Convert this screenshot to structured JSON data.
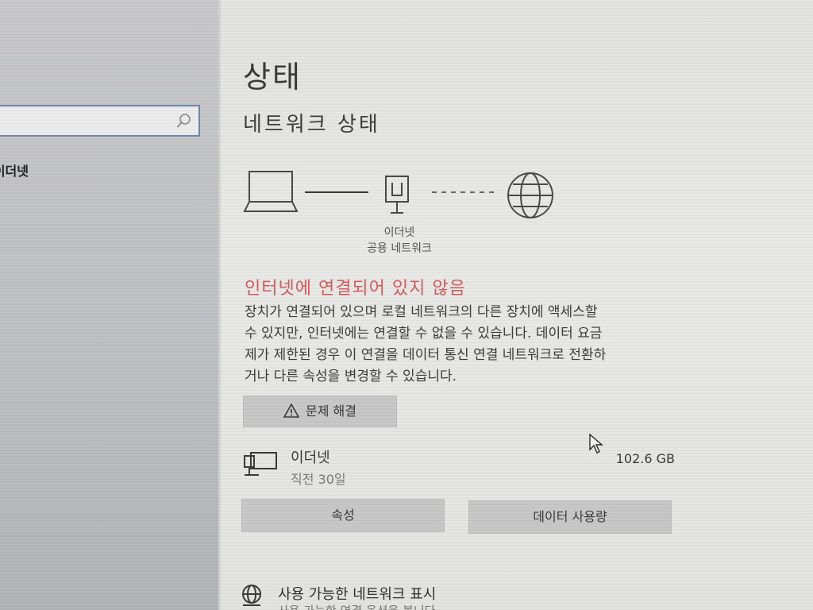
{
  "sidebar": {
    "search": {
      "placeholder": "",
      "icon": "search-icon"
    },
    "items": [
      {
        "label": "이더넷"
      }
    ]
  },
  "main": {
    "page_title": "상태",
    "section_title": "네트워크 상태",
    "network_diagram": {
      "adapter_name": "이더넷",
      "network_type": "공용 네트워크"
    },
    "alert": {
      "title": "인터넷에 연결되어 있지 않음",
      "body_lines": [
        "장치가 연결되어 있으며 로컬 네트워크의 다른 장치에 액세스할",
        "수 있지만, 인터넷에는 연결할 수 없을 수 있습니다. 데이터 요금",
        "제가 제한된 경우 이 연결을 데이터 통신 연결 네트워크로 전환하",
        "거나 다른 속성을 변경할 수 있습니다."
      ],
      "color": "#d95a5a"
    },
    "troubleshoot_label": "문제 해결",
    "connection": {
      "name": "이더넷",
      "time": "직전 30일",
      "usage": "102.6 GB"
    },
    "properties_label": "속성",
    "data_usage_label": "데이터 사용량",
    "show_networks": {
      "label": "사용 가능한 네트워크 표시",
      "sub": "사용 가능한 연결 옵션을 봅니다"
    }
  }
}
